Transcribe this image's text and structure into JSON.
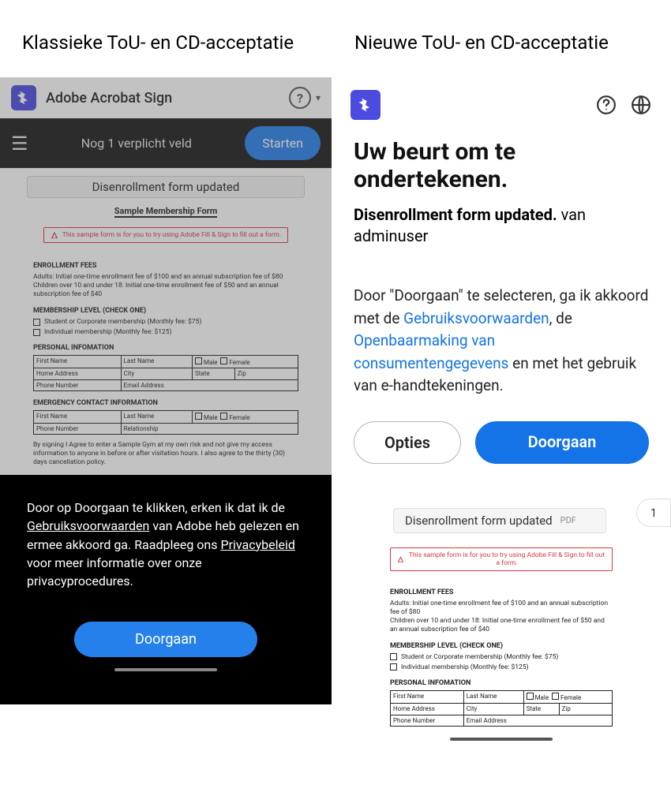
{
  "labels": {
    "classic": "Klassieke ToU- en CD-acceptatie",
    "new": "Nieuwe ToU- en CD-acceptatie"
  },
  "classic": {
    "app_title": "Adobe Acrobat Sign",
    "toolbar_text": "Nog 1 verplicht veld",
    "start_btn": "Starten",
    "doc_title": "Disenrollment form updated",
    "form_title": "Sample Membership Form",
    "red_notice": "This sample form is for you to try using Adobe Fill & Sign to fill out a form.",
    "sect_fees": "ENROLLMENT FEES",
    "fee_adults": "Adults: Initial one-time enrollment fee of $100 and an annual subscription fee of $80",
    "fee_children": "Children over 10 and under 18: Initial one-time enrollment fee of $50 and an annual subscription fee of $40",
    "sect_level": "MEMBERSHIP LEVEL (CHECK ONE)",
    "level1": "Student or Corporate membership (Monthly fee: $75)",
    "level2": "Individual membership (Monthly fee: $125)",
    "sect_personal": "PERSONAL INFOMATION",
    "fn": "First Name",
    "ln": "Last Name",
    "male": "Male",
    "female": "Female",
    "home": "Home Address",
    "city": "City",
    "state": "State",
    "zip": "Zip",
    "phone": "Phone Number",
    "email": "Email Address",
    "sect_emerg": "EMERGENCY CONTACT INFORMATION",
    "relationship": "Relationship",
    "agree": "By signing I Agree to enter a Sample Gym at my own risk and not give my access information to anyone in before or after visitation hours. I also agree to the thirty (30) days cancellation policy.",
    "footer_pre": "Door op Doorgaan te klikken, erken ik dat ik de ",
    "footer_link1": "Gebruiksvoorwaarden",
    "footer_mid1": " van Adobe heb gelezen en ermee akkoord ga. Raadpleeg ons ",
    "footer_link2": "Privacybeleid",
    "footer_post": " voor meer informatie over onze privacyprocedures.",
    "continue": "Doorgaan"
  },
  "new": {
    "heading": "Uw beurt om te ondertekenen.",
    "doc_name": "Disenrollment form updated.",
    "from": " van adminuser",
    "consent_pre": "Door \"Doorgaan\" te selecteren, ga ik akkoord met de ",
    "link1": "Gebruiksvoorwaarden",
    "mid1": ", de ",
    "link2": "Openbaarmaking van consumentengegevens",
    "post": " en met het gebruik van e-handtekeningen.",
    "options": "Opties",
    "continue": "Doorgaan",
    "pill_title": "Disenrollment form updated",
    "pill_badge": "PDF",
    "page": "1",
    "red_notice": "This sample form is for you to try using Adobe Fill & Sign to fill out a form.",
    "sect_fees": "ENROLLMENT FEES",
    "fee_adults": "Adults: Initial one-time enrollment fee of $100 and an annual subscription fee of $80",
    "fee_children": "Children over 10 and under 18: Initial one-time enrollment fee of $50 and an annual subscription fee of $40",
    "sect_level": "MEMBERSHIP LEVEL (CHECK ONE)",
    "level1": "Student or Corporate membership (Monthly fee: $75)",
    "level2": "Individual membership (Monthly fee: $125)",
    "sect_personal": "PERSONAL INFOMATION",
    "fn": "First Name",
    "ln": "Last Name",
    "male": "Male",
    "female": "Female",
    "home": "Home Address",
    "city": "City",
    "state": "State",
    "zip": "Zip",
    "phone": "Phone Number",
    "email": "Email Address"
  }
}
